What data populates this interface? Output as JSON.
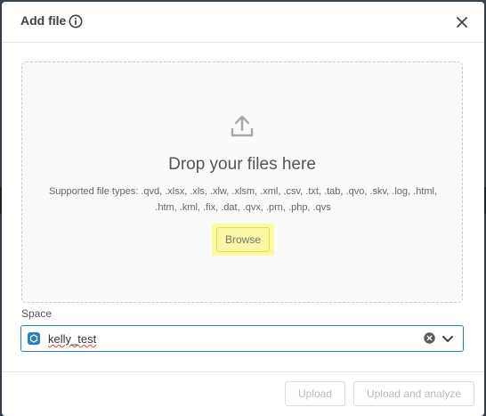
{
  "dialog": {
    "title": "Add file",
    "info_icon": "info-icon",
    "close_icon": "close-icon"
  },
  "dropzone": {
    "upload_icon": "upload-icon",
    "title": "Drop your files here",
    "supported_line1": "Supported file types: .qvd, .xlsx, .xls, .xlw, .xlsm, .xml, .csv, .txt, .tab, .qvo, .skv, .log, .html,",
    "supported_line2": ".htm, .kml, .fix, .dat, .qvx, .prn, .php, .qvs",
    "browse_label": "Browse"
  },
  "space": {
    "label": "Space",
    "value": "kelly_test",
    "space_icon": "space-icon",
    "clear_icon": "clear-icon",
    "dropdown_icon": "chevron-down-icon"
  },
  "footer": {
    "upload_label": "Upload",
    "upload_analyze_label": "Upload and analyze"
  },
  "colors": {
    "accent": "#2c7fbd",
    "highlight": "#fbfa9e",
    "disabled_text": "#b9b9b9"
  }
}
